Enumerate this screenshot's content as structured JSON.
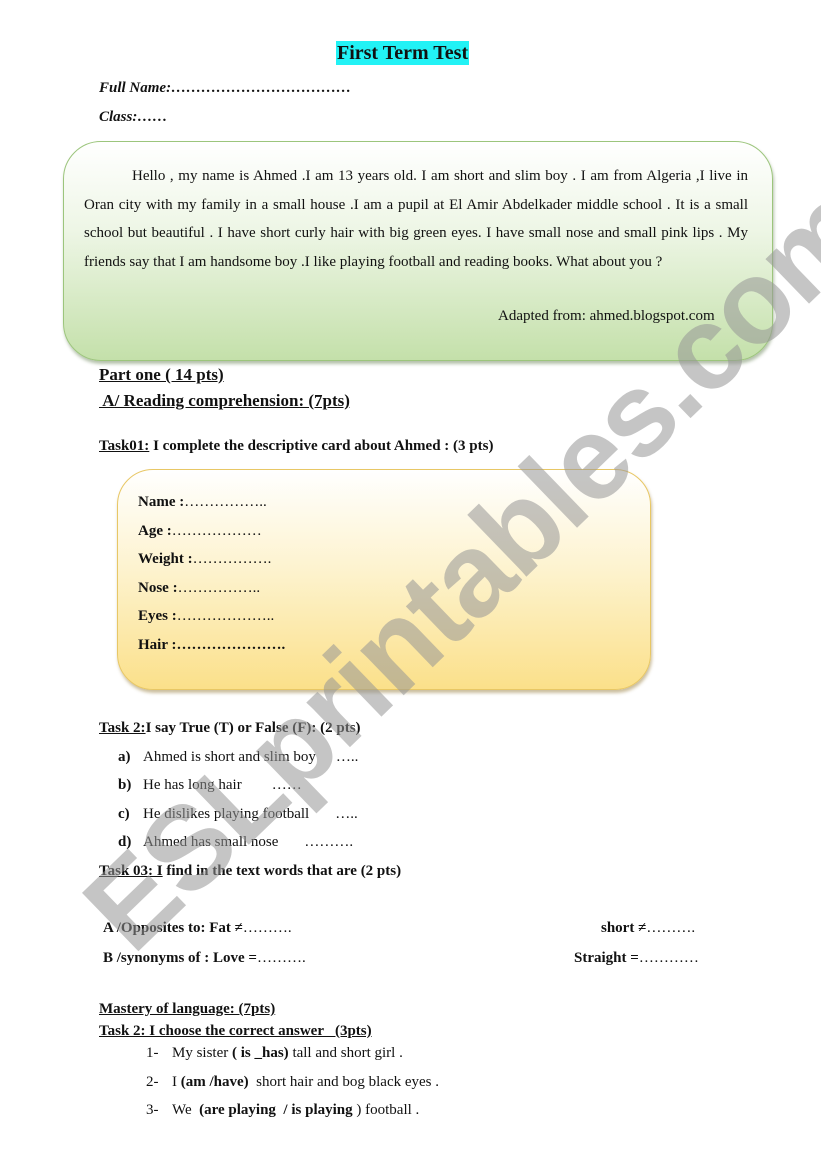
{
  "header": {
    "title": "First Term Test",
    "full_name": "Full Name:………………………………",
    "class": "Class:……"
  },
  "passage": {
    "text": "Hello , my name is Ahmed .I am  13 years old. I am short and slim boy . I am  from Algeria ,I live in Oran city  with my family in a small house .I am a pupil at El Amir Abdelkader   middle school . It is a small school but beautiful . I have  short curly  hair with big green eyes. I have small nose and small pink lips . My friends say that I am handsome boy .I like playing football and reading books. What about you ?",
    "source": "Adapted from: ahmed.blogspot.com",
    "box_color": "#c4e0aa"
  },
  "part_one": {
    "title": "Part one ( 14 pts)",
    "reading": " A/ Reading comprehension: (7pts)"
  },
  "task1": {
    "label": "Task01:",
    "instruction": " I complete the descriptive card about Ahmed : (3 pts)",
    "box_color": "#fbe08a",
    "card": [
      {
        "label": "Name :",
        "dots": "…………….."
      },
      {
        "label": "Age :",
        "dots": "………………"
      },
      {
        "label": "Weight :",
        "dots": "……………."
      },
      {
        "label": "Nose  :",
        "dots": "…………….."
      },
      {
        "label": "Eyes :",
        "dots": "……………….."
      },
      {
        "label": "Hair :",
        "dots": "…………………."
      }
    ]
  },
  "task2": {
    "label": "Task 2:",
    "instruction": "I say True (T) or False (F): (2 pts)",
    "items": [
      {
        "letter": "a)",
        "text": "Ahmed  is short and slim boy",
        "blank": "….."
      },
      {
        "letter": "b)",
        "text": "He has long hair",
        "blank": "……"
      },
      {
        "letter": "c)",
        "text": "He dislikes playing football",
        "blank": "….."
      },
      {
        "letter": "d)",
        "text": "Ahmed has small nose",
        "blank": "………."
      }
    ]
  },
  "task3": {
    "label": "Task 03: I",
    "instruction": " find in the text words that are (2 pts)",
    "opposites_label": "A /Opposites to: Fat  ≠",
    "opposites_blank": "……….",
    "opposites_right_label": "short  ≠",
    "opposites_right_blank": "……….",
    "synonyms_label": "B /synonyms of :  Love =",
    "synonyms_blank": "……….",
    "synonyms_right_label": "Straight =",
    "synonyms_right_blank": "…………"
  },
  "mastery": {
    "title": "Mastery of language: (7pts)",
    "task_label": "Task 2: I choose the correct answer   (3pts)",
    "items": [
      {
        "num": "1-",
        "pre": "My sister ",
        "choice": "( is _has)",
        "post": " tall and short girl ."
      },
      {
        "num": "2-",
        "pre": "I ",
        "choice": "(am /have)",
        "post": "  short hair and bog black eyes ."
      },
      {
        "num": "3-",
        "pre": "We  ",
        "choice": "(are playing  / is playing ",
        "post": ") football ."
      }
    ]
  },
  "watermark": "ESLprintables.com",
  "colors": {
    "title_highlight": "#22f2f5"
  }
}
